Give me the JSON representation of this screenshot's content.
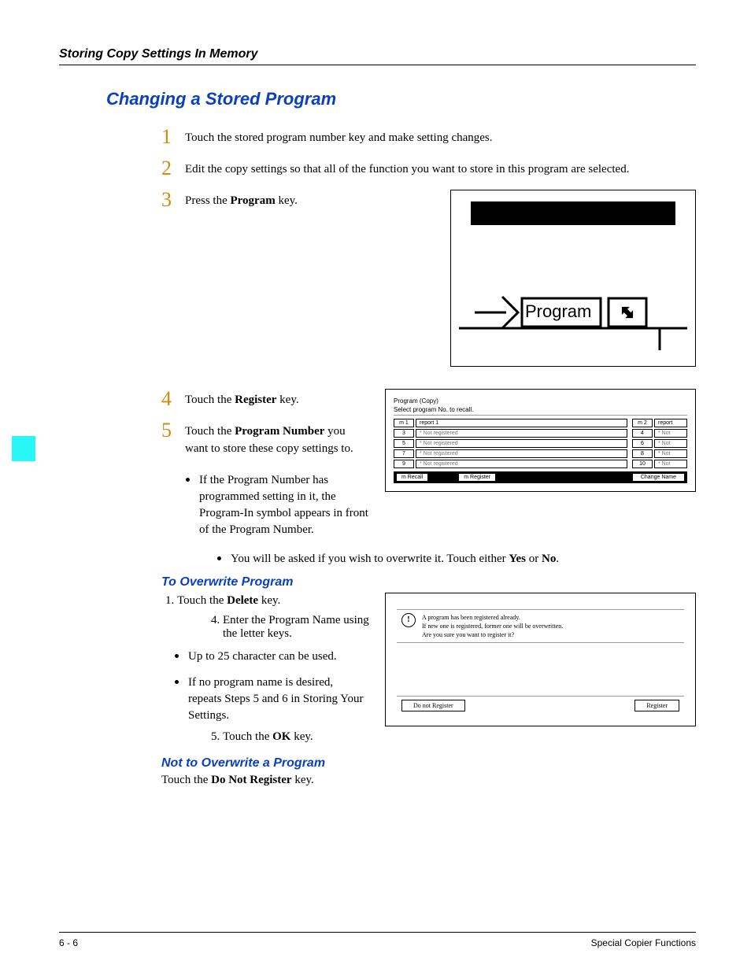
{
  "header": {
    "running": "Storing Copy Settings In Memory"
  },
  "h2": "Changing a Stored Program",
  "steps": {
    "s1": "Touch the stored program number key and make setting changes.",
    "s2": "Edit the copy settings so that all of the function you want to store in this program are selected.",
    "s3_pre": "Press the ",
    "s3_bold": "Program",
    "s3_post": " key.",
    "s4_pre": "Touch the ",
    "s4_bold": "Register",
    "s4_post": " key.",
    "s5_pre": "Touch the ",
    "s5_bold": "Program Number",
    "s5_post": " you want to store these copy settings to."
  },
  "fig1": {
    "button_label": "Program"
  },
  "bullets45": {
    "b1": "If the Program Number has programmed setting in it, the Program-In symbol appears in front of the Program Number.",
    "b2_pre": "You will be asked if you wish to overwrite it. Touch either ",
    "b2_yes": "Yes",
    "b2_mid": " or ",
    "b2_no": "No",
    "b2_post": "."
  },
  "fig2": {
    "title": "Program (Copy)",
    "subtitle": "Select program No. to recall.",
    "left": [
      {
        "num": "m 1",
        "txt": "report 1"
      },
      {
        "num": "3",
        "txt": "* Not registered"
      },
      {
        "num": "5",
        "txt": "* Not registered"
      },
      {
        "num": "7",
        "txt": "* Not registered"
      },
      {
        "num": "9",
        "txt": "* Not registered"
      }
    ],
    "right": [
      {
        "num": "m 2",
        "txt": "report"
      },
      {
        "num": "4",
        "txt": "* Not"
      },
      {
        "num": "6",
        "txt": "* Not"
      },
      {
        "num": "8",
        "txt": "* Not"
      },
      {
        "num": "10",
        "txt": "* Not"
      }
    ],
    "btn_recall": "m Recall",
    "btn_register": "m Register",
    "btn_change": "Change Name"
  },
  "overwrite": {
    "heading": "To Overwrite Program",
    "li1_pre": "Touch the ",
    "li1_bold": "Delete",
    "li1_post": " key.",
    "li4": "Enter the Program Name using the letter keys.",
    "b1": "Up to 25 character can be used.",
    "b2": "If no program name is desired, repeats Steps 5 and 6 in Storing Your Settings.",
    "li5_pre": "Touch the ",
    "li5_bold": "OK",
    "li5_post": " key."
  },
  "fig3": {
    "line1": "A program has been registered already.",
    "line2": "If new one is registered, former one will be overwritten.",
    "line3": "Are you sure you want to register it?",
    "btn_no": "Do not Register",
    "btn_yes": "Register"
  },
  "not_overwrite": {
    "heading": "Not to Overwrite a Program",
    "txt_pre": "Touch the ",
    "txt_bold": "Do Not Register",
    "txt_post": " key."
  },
  "footer": {
    "left": "6 - 6",
    "right": "Special Copier Functions"
  }
}
